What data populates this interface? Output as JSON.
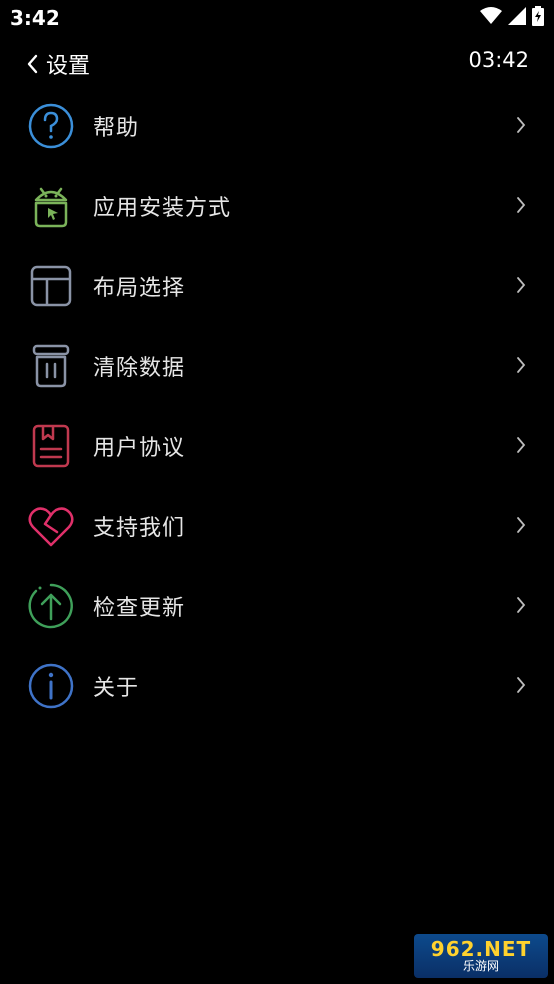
{
  "status_bar": {
    "time": "3:42"
  },
  "header": {
    "back_label": "设置",
    "clock": "03:42"
  },
  "menu": [
    {
      "label": "帮助",
      "icon": "help-circle-icon",
      "color": "#3b8fd9"
    },
    {
      "label": "应用安装方式",
      "icon": "android-install-icon",
      "color": "#7bb35a"
    },
    {
      "label": "布局选择",
      "icon": "layout-icon",
      "color": "#8a93a6"
    },
    {
      "label": "清除数据",
      "icon": "trash-icon",
      "color": "#8a93a6"
    },
    {
      "label": "用户协议",
      "icon": "agreement-doc-icon",
      "color": "#c0394f"
    },
    {
      "label": "支持我们",
      "icon": "heart-icon",
      "color": "#e0306a"
    },
    {
      "label": "检查更新",
      "icon": "update-arrow-icon",
      "color": "#3fa05a"
    },
    {
      "label": "关于",
      "icon": "info-icon",
      "color": "#3f73c8"
    }
  ],
  "watermark": {
    "logo": "962.NET",
    "sub": "乐游网"
  }
}
